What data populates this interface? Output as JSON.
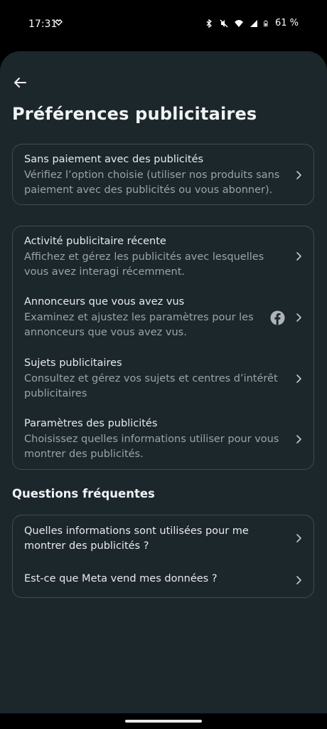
{
  "status": {
    "time": "17:31",
    "battery": "61 %"
  },
  "header": {
    "back_icon": "arrow-left-icon",
    "title": "Préférences publicitaires"
  },
  "card_payment": {
    "title": "Sans paiement avec des publicités",
    "desc": "Vérifiez l’option choisie (utiliser nos produits sans paiement avec des publicités ou vous abonner)."
  },
  "card_ads": {
    "items": [
      {
        "title": "Activité publicitaire récente",
        "desc": "Affichez et gérez les publicités avec lesquelles vous avez interagi récemment."
      },
      {
        "title": "Annonceurs que vous avez vus",
        "desc": "Examinez et ajustez les paramètres pour les annonceurs que vous avez vus.",
        "icon": "facebook-icon"
      },
      {
        "title": "Sujets publicitaires",
        "desc": "Consultez et gérez vos sujets et centres d’intérêt publicitaires"
      },
      {
        "title": "Paramètres des publicités",
        "desc": "Choisissez quelles informations utiliser pour vous montrer des publicités."
      }
    ]
  },
  "faq": {
    "title": "Questions fréquentes",
    "items": [
      {
        "title": "Quelles informations sont utilisées pour me montrer des publicités ?"
      },
      {
        "title": "Est-ce que Meta vend mes données ?"
      }
    ]
  },
  "colors": {
    "background": "#1c272c",
    "card_border": "#414c52",
    "secondary_text": "#9aa3a8"
  }
}
